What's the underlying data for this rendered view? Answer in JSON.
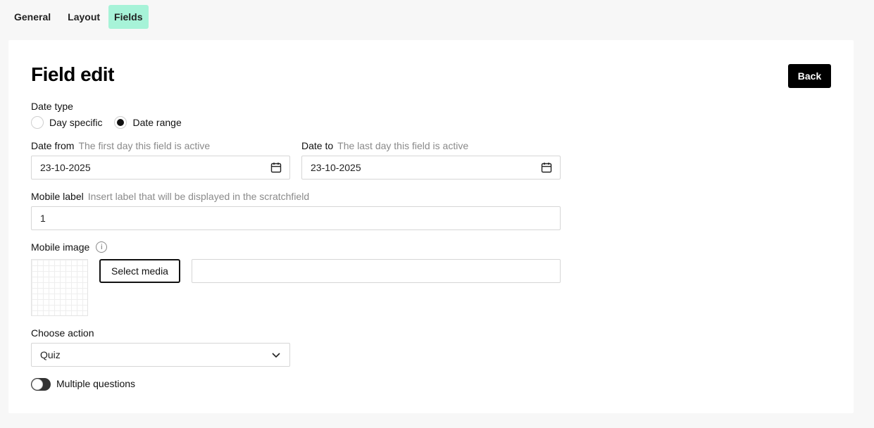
{
  "tabs": [
    {
      "label": "General",
      "active": false
    },
    {
      "label": "Layout",
      "active": false
    },
    {
      "label": "Fields",
      "active": true
    }
  ],
  "page": {
    "title": "Field edit",
    "back_label": "Back"
  },
  "date_type": {
    "label": "Date type",
    "options": [
      "Day specific",
      "Date range"
    ],
    "selected": "Date range"
  },
  "date_from": {
    "label": "Date from",
    "hint": "The first day this field is active",
    "value": "23-10-2025",
    "icon": "calendar-icon"
  },
  "date_to": {
    "label": "Date to",
    "hint": "The last day this field is active",
    "value": "23-10-2025",
    "icon": "calendar-icon"
  },
  "mobile_label": {
    "label": "Mobile label",
    "hint": "Insert label that will be displayed in the scratchfield",
    "value": "1"
  },
  "mobile_image": {
    "label": "Mobile image",
    "info_icon": "info-icon",
    "select_label": "Select media",
    "value": ""
  },
  "choose_action": {
    "label": "Choose action",
    "value": "Quiz",
    "icon": "chevron-down-icon"
  },
  "multiple_questions": {
    "label": "Multiple questions",
    "enabled": false
  },
  "colors": {
    "accent_tab": "#a7f3d8",
    "primary": "#000000"
  }
}
